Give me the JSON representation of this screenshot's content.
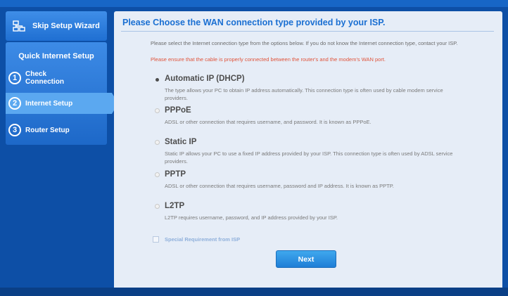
{
  "sidebar": {
    "skip_wizard_label": "Skip Setup Wizard",
    "section_title": "Quick Internet Setup",
    "steps": [
      {
        "number": "1",
        "label_line1": "Check",
        "label_line2": "Connection"
      },
      {
        "number": "2",
        "label_line1": "Internet Setup",
        "label_line2": ""
      },
      {
        "number": "3",
        "label_line1": "Router Setup",
        "label_line2": ""
      }
    ],
    "active_step": "2"
  },
  "main": {
    "title": "Please Choose the WAN connection type provided by your ISP.",
    "intro": "Please select the Internet connection type from the options below. If you do not know the Internet connection type, contact your ISP.",
    "warning": "Please ensure that the cable is properly connected between the router's and the modem's WAN port.",
    "options": [
      {
        "name": "Automatic IP (DHCP)",
        "desc": "The type allows your PC to obtain IP address automatically. This connection type is often used by cable modem service providers.",
        "selected": true
      },
      {
        "name": "PPPoE",
        "desc": "ADSL or other connection that requires username, and password. It is known as PPPoE.",
        "selected": false
      },
      {
        "name": "Static IP",
        "desc": "Static IP allows your PC to use a fixed IP address provided by your ISP. This connection type is often used by ADSL service providers.",
        "selected": false
      },
      {
        "name": "PPTP",
        "desc": "ADSL or other connection that requires username, password and IP address. It is known as PPTP.",
        "selected": false
      },
      {
        "name": "L2TP",
        "desc": "L2TP requires username, password, and IP address provided by your ISP.",
        "selected": false
      }
    ],
    "special_requirement_label": "Special Requirement from ISP",
    "next_label": "Next"
  },
  "colors": {
    "background": "#0d4fa6",
    "panel": "#e6edf7",
    "title": "#1a6fd2",
    "warning": "#e0533a",
    "nav_active": "#5ba8f0"
  },
  "icons": {
    "skip_wizard": "network-icon"
  }
}
